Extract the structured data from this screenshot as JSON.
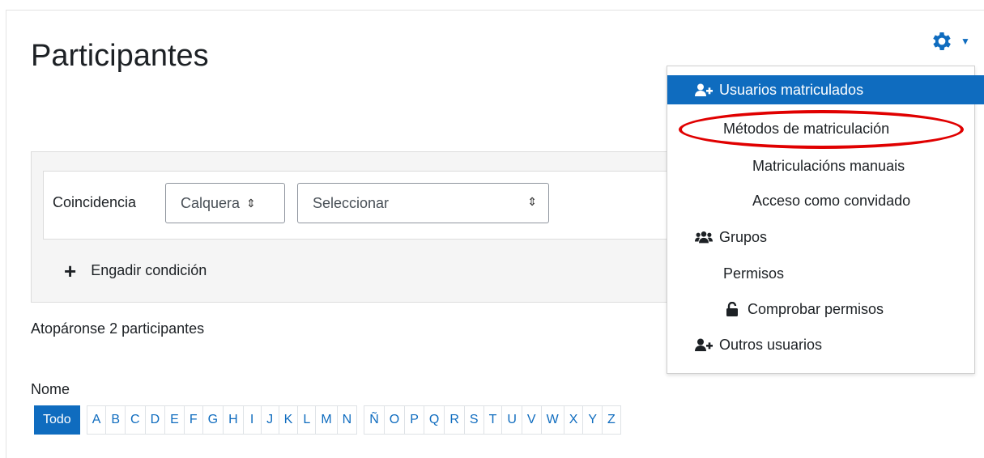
{
  "page": {
    "title": "Participantes"
  },
  "filters": {
    "match_label": "Coincidencia",
    "match_select": "Calquera",
    "value_select": "Seleccionar",
    "add_condition": "Engadir condición"
  },
  "summary": {
    "found_text": "Atopáronse 2 participantes"
  },
  "initials": {
    "label": "Nome",
    "all_label": "Todo",
    "letters": [
      "A",
      "B",
      "C",
      "D",
      "E",
      "F",
      "G",
      "H",
      "I",
      "J",
      "K",
      "L",
      "M",
      "N",
      "Ñ",
      "O",
      "P",
      "Q",
      "R",
      "S",
      "T",
      "U",
      "V",
      "W",
      "X",
      "Y",
      "Z"
    ]
  },
  "menu": {
    "items": [
      {
        "label": "Usuarios matriculados",
        "icon": "user-plus-icon"
      },
      {
        "label": "Métodos de matriculación",
        "icon": ""
      },
      {
        "label": "Matriculacións manuais",
        "icon": ""
      },
      {
        "label": "Acceso como convidado",
        "icon": ""
      },
      {
        "label": "Grupos",
        "icon": "users-icon"
      },
      {
        "label": "Permisos",
        "icon": ""
      },
      {
        "label": "Comprobar permisos",
        "icon": "unlock-icon"
      },
      {
        "label": "Outros usuarios",
        "icon": "user-plus-icon"
      }
    ]
  },
  "colors": {
    "accent": "#0f6cbf",
    "highlight_ring": "#e00000"
  }
}
